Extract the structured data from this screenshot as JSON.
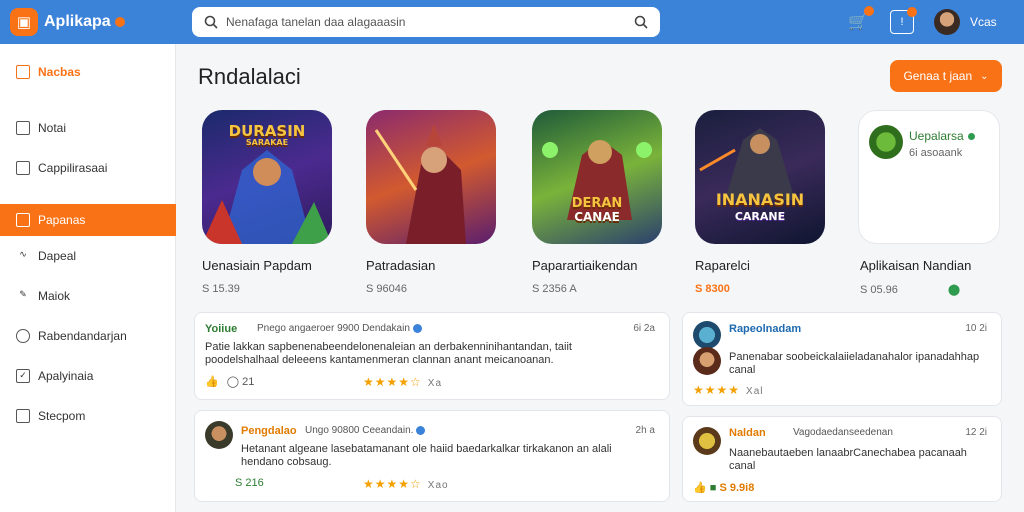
{
  "header": {
    "brand": "Aplikapa",
    "search_text": "Nenafaga tanelan daa alagaaasin",
    "user_label": "Vcas"
  },
  "sidebar": {
    "items": [
      {
        "label": "Nacbas",
        "icon": "grid-icon"
      },
      {
        "label": "Notai",
        "icon": "image-icon"
      },
      {
        "label": "Cappilirasaai",
        "icon": "list-icon"
      },
      {
        "label": "Papanas",
        "icon": "card-icon"
      },
      {
        "label": "Dapeal",
        "icon": "wave-icon"
      },
      {
        "label": "Maiok",
        "icon": "edit-icon"
      },
      {
        "label": "Rabendandarjan",
        "icon": "gauge-icon"
      },
      {
        "label": "Apalyinaia",
        "icon": "check-icon"
      },
      {
        "label": "Stecpom",
        "icon": "monitor-icon"
      }
    ]
  },
  "main": {
    "title": "Rndalalaci",
    "filter_button": "Genaa t jaan",
    "apps": [
      {
        "name": "Uenasiain Papdam",
        "price": "S 15.39",
        "art": "DURASIN",
        "art_sub": "SARAKAE"
      },
      {
        "name": "Patradasian",
        "price": "S 96046",
        "art": "",
        "art_sub": ""
      },
      {
        "name": "Paparartiaikendan",
        "price": "S 2356 A",
        "art": "DERAN",
        "art_sub": "CANAE"
      },
      {
        "name": "Raparelci",
        "price": "S 8300",
        "art": "INANASIN",
        "art_sub": "CARANE"
      },
      {
        "name": "Aplikaisan Nandian",
        "price": "S 05.96",
        "art": "",
        "art_sub": ""
      }
    ],
    "promo": {
      "name": "Uepalarsa",
      "sub": "6i asoaank"
    },
    "reviews": [
      {
        "name": "Yoiiue",
        "meta": "Pnego angaeroer 9900 Dendakain",
        "time": "6i 2a",
        "text": "Patie lakkan sapbenenabeendelonenaleian an derbakenninihantandan, taiit poodelshalhaal deleeens kantamenmeran clannan anant meicanoanan.",
        "likes": "21",
        "rating_text": "Xa"
      },
      {
        "name": "Rapeolnadam",
        "meta": "",
        "time": "10 2i",
        "text": "Panenabar soobeickalaiieladanahalor ipanadahhap canal",
        "likes": "",
        "rating_text": "Xal"
      },
      {
        "name": "Pengdalao",
        "meta": "Ungo 90800 Ceeandain.",
        "time": "2h a",
        "text": "Hetanant algeane lasebatamanant ole haiid baedarkalkar tirkakanon an alali hendano cobsaug.",
        "price": "S 216",
        "rating_text": "Xao"
      },
      {
        "name": "Naldan",
        "meta": "Vagodaedanseedenan",
        "time": "12 2i",
        "text": "Naanebautaeben lanaabrCanechabea pacanaah canal",
        "price": "S 9.9i8",
        "rating_text": ""
      }
    ]
  },
  "colors": {
    "accent": "#f97316",
    "topbar": "#3b82d9"
  }
}
